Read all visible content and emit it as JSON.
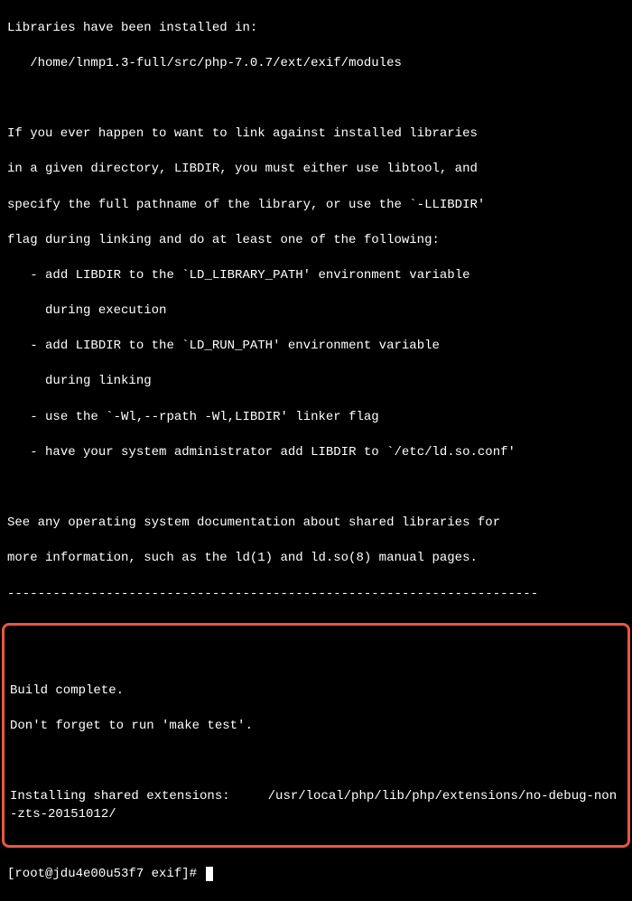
{
  "output": {
    "line1": "Libraries have been installed in:",
    "line2": "   /home/lnmp1.3-full/src/php-7.0.7/ext/exif/modules",
    "blank1": "",
    "line3": "If you ever happen to want to link against installed libraries",
    "line4": "in a given directory, LIBDIR, you must either use libtool, and",
    "line5": "specify the full pathname of the library, or use the `-LLIBDIR'",
    "line6": "flag during linking and do at least one of the following:",
    "line7": "   - add LIBDIR to the `LD_LIBRARY_PATH' environment variable",
    "line8": "     during execution",
    "line9": "   - add LIBDIR to the `LD_RUN_PATH' environment variable",
    "line10": "     during linking",
    "line11": "   - use the `-Wl,--rpath -Wl,LIBDIR' linker flag",
    "line12": "   - have your system administrator add LIBDIR to `/etc/ld.so.conf'",
    "blank2": "",
    "line13": "See any operating system documentation about shared libraries for",
    "line14": "more information, such as the ld(1) and ld.so(8) manual pages.",
    "separator": "----------------------------------------------------------------------"
  },
  "highlighted": {
    "blank1": "",
    "line1": "Build complete.",
    "line2": "Don't forget to run 'make test'.",
    "blank2": "",
    "line3": "Installing shared extensions:     /usr/local/php/lib/php/extensions/no-debug-non-zts-20151012/"
  },
  "prompt": {
    "text": "[root@jdu4e00u53f7 exif]# "
  }
}
